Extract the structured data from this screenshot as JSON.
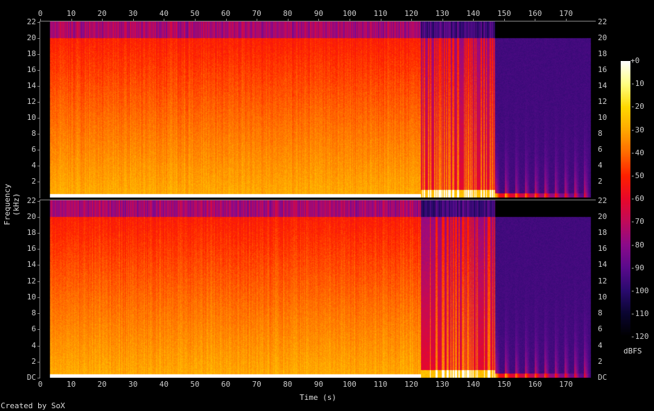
{
  "chart_data": {
    "type": "heatmap",
    "title": "",
    "xlabel": "Time (s)",
    "ylabel": "Frequency (kHz)",
    "colorbar_label": "dBFS",
    "credit": "Created by SoX",
    "xlim": [
      0,
      179.4
    ],
    "ylim": [
      0,
      22.05
    ],
    "x_ticks": [
      "0",
      "10",
      "20",
      "30",
      "40",
      "50",
      "60",
      "70",
      "80",
      "90",
      "100",
      "110",
      "120",
      "130",
      "140",
      "150",
      "160",
      "170"
    ],
    "y_ticks_top_channel": [
      "2",
      "4",
      "6",
      "8",
      "10",
      "12",
      "14",
      "16",
      "18",
      "20",
      "22"
    ],
    "y_ticks_bottom_channel": [
      "DC",
      "2",
      "4",
      "6",
      "8",
      "10",
      "12",
      "14",
      "16",
      "18",
      "20",
      "22"
    ],
    "colorbar_ticks": [
      "+0",
      "-10",
      "-20",
      "-30",
      "-40",
      "-50",
      "-60",
      "-70",
      "-80",
      "-90",
      "-100",
      "-110",
      "-120"
    ],
    "colorbar_range_dbfs": [
      -120,
      0
    ],
    "channels": 2,
    "colormap": [
      "#000000",
      "#0a0530",
      "#2a0a6e",
      "#5a0a8c",
      "#8c0a8a",
      "#c00a5a",
      "#e8082a",
      "#ff2000",
      "#ff6a00",
      "#ffa800",
      "#ffd800",
      "#ffff80",
      "#ffffff"
    ],
    "segments": [
      {
        "start_s": 0,
        "end_s": 3,
        "description": "silence",
        "level_db": -120,
        "cutoff_khz": 0
      },
      {
        "start_s": 3,
        "end_s": 123,
        "description": "broadband",
        "level_db": -40,
        "cutoff_khz": 20
      },
      {
        "start_s": 123,
        "end_s": 147,
        "description": "transient columns",
        "level_db": -60,
        "cutoff_khz": 20
      },
      {
        "start_s": 147,
        "end_s": 178,
        "description": "decaying notes",
        "level_db": -95,
        "cutoff_khz": 20
      },
      {
        "start_s": 178,
        "end_s": 179.4,
        "description": "silence",
        "level_db": -120,
        "cutoff_khz": 0
      }
    ]
  }
}
